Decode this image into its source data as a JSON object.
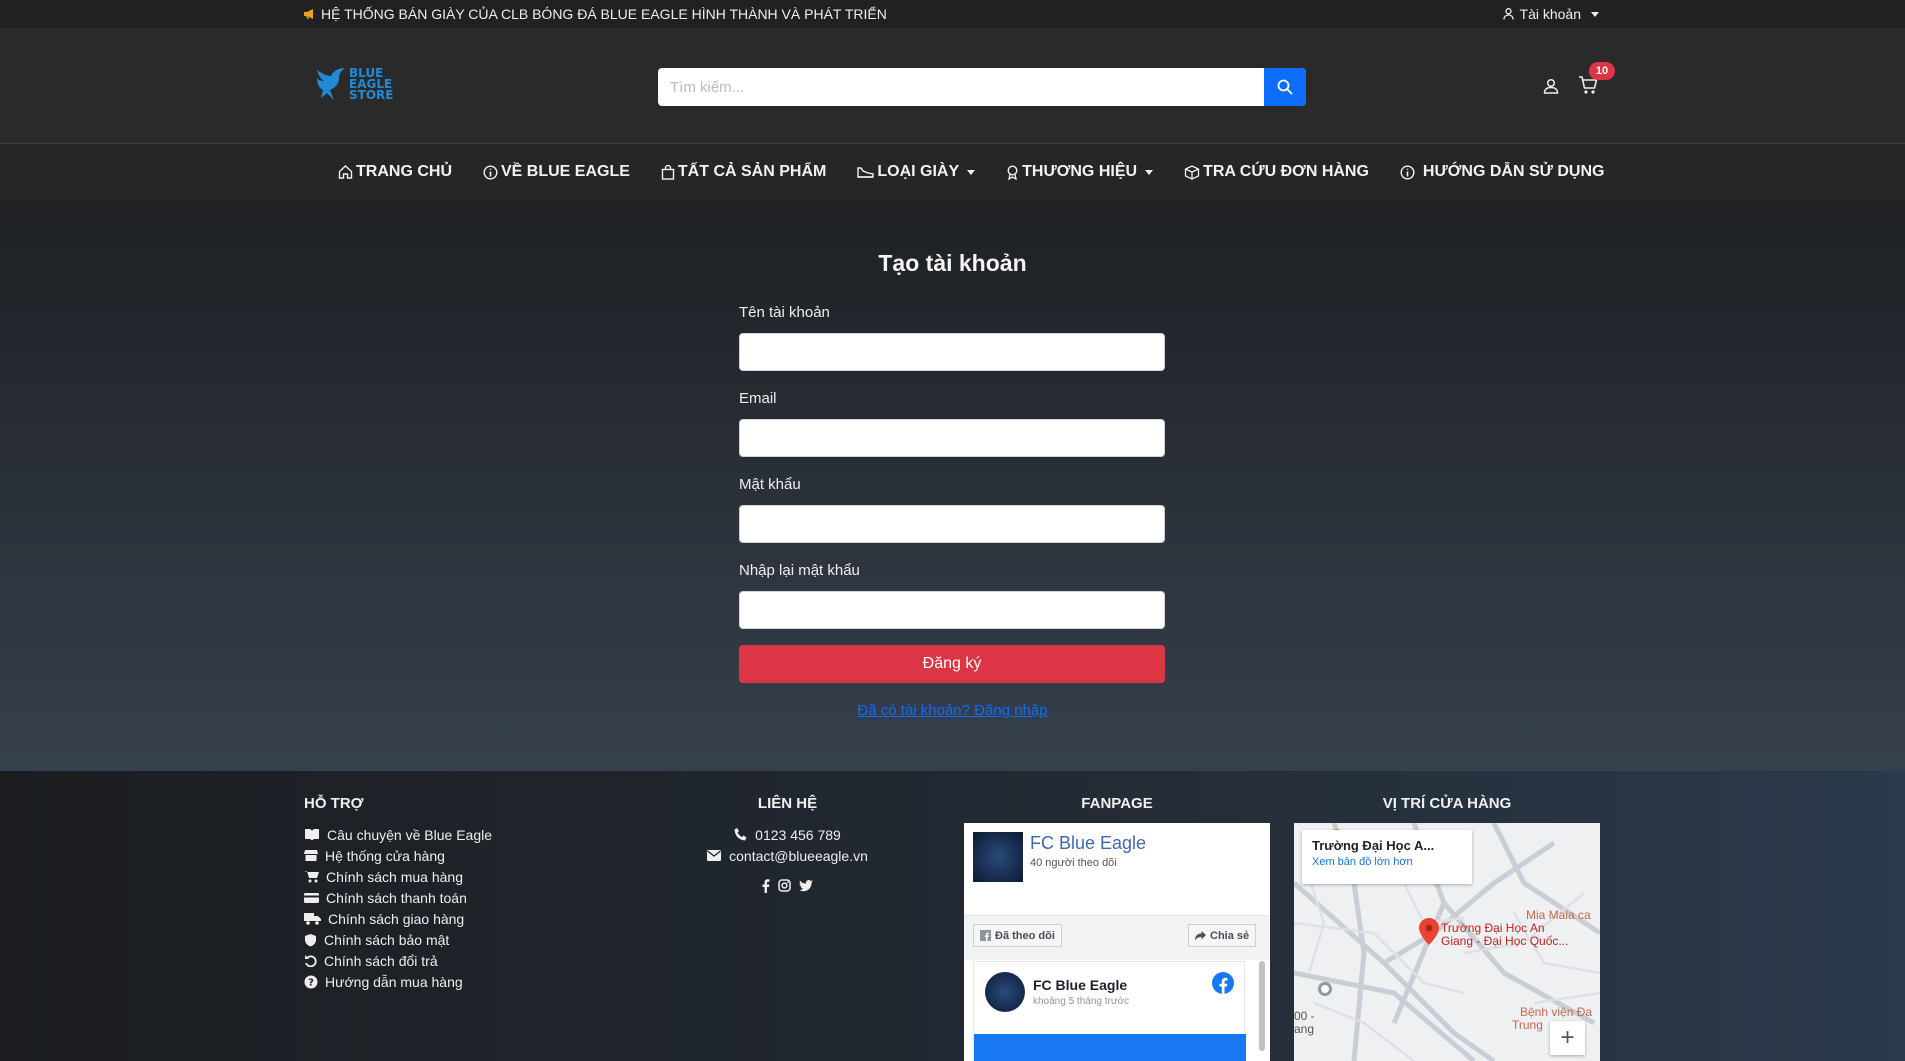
{
  "topbar": {
    "marquee": "HỆ THỐNG BÁN GIÀY CỦA CLB BÓNG ĐÁ BLUE EAGLE HÌNH THÀNH VÀ PHÁT TRIỂN",
    "account_label": "Tài khoản"
  },
  "header": {
    "logo_lines": [
      "BLUE",
      "EAGLE",
      "STORE"
    ],
    "search_placeholder": "Tìm kiếm...",
    "cart_count": "10"
  },
  "nav": {
    "items": [
      {
        "label": "TRANG CHỦ",
        "icon": "home-icon"
      },
      {
        "label": "VỀ BLUE EAGLE",
        "icon": "info-icon"
      },
      {
        "label": "TẤT CẢ SẢN PHẨM",
        "icon": "bag-icon"
      },
      {
        "label": "LOẠI GIÀY",
        "icon": "shoe-icon",
        "dropdown": true
      },
      {
        "label": "THƯƠNG HIỆU",
        "icon": "award-icon",
        "dropdown": true
      },
      {
        "label": "TRA CỨU ĐƠN HÀNG",
        "icon": "box-icon"
      },
      {
        "label": "HƯỚNG DẪN SỬ DỤNG",
        "icon": "info-icon"
      }
    ]
  },
  "form": {
    "title": "Tạo tài khoản",
    "username_label": "Tên tài khoản",
    "email_label": "Email",
    "password_label": "Mật khẩu",
    "confirm_label": "Nhập lại mật khẩu",
    "submit_label": "Đăng ký",
    "login_link": "Đã có tài khoản? Đăng nhập"
  },
  "footer": {
    "support_title": "HỖ TRỢ",
    "support_items": [
      "Câu chuyện về Blue Eagle",
      "Hệ thống cửa hàng",
      "Chính sách mua hàng",
      "Chính sách thanh toán",
      "Chính sách giao hàng",
      "Chính sách bảo mật",
      "Chính sách đổi trả",
      "Hướng dẫn mua hàng"
    ],
    "contact_title": "LIÊN HỆ",
    "phone": "0123 456 789",
    "email": "contact@blueeagle.vn",
    "fanpage_title": "FANPAGE",
    "fb_page_name": "FC Blue Eagle",
    "fb_followers": "40 người theo dõi",
    "fb_follow_btn": "Đã theo dõi",
    "fb_share_btn": "Chia sẻ",
    "fb_post_name": "FC Blue Eagle",
    "fb_post_time": "khoảng 5 tháng trước",
    "map_title": "VỊ TRÍ CỬA HÀNG",
    "map_place": "Trường Đại Học A...",
    "map_link": "Xem bản đồ lớn hơn",
    "map_pin_label_1": "Trường Đại Học An",
    "map_pin_label_2": "Giang - Đại Học Quốc...",
    "map_label_mia": "Mia Maia ca",
    "map_label_benh": "Bệnh viện Đa",
    "map_label_trung": "Trung",
    "map_label_00": "00 -",
    "map_label_ang": "ang"
  }
}
